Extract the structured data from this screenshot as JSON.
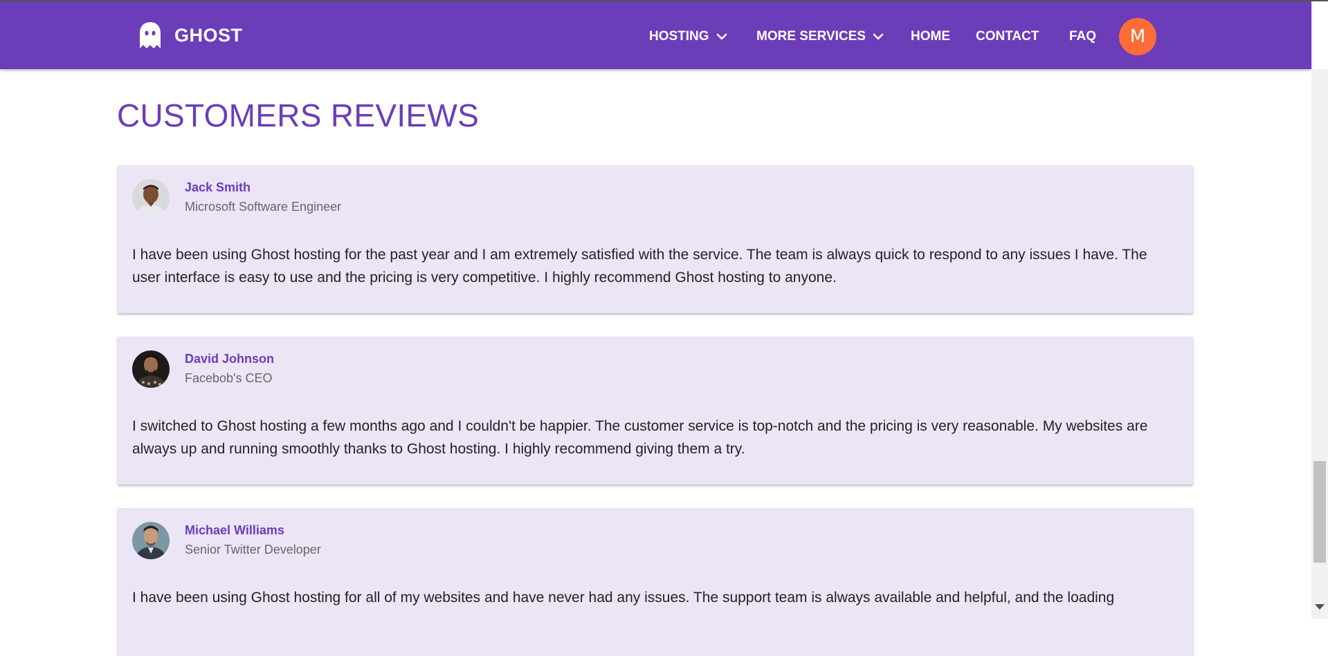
{
  "brand": {
    "name": "GHOST",
    "icon": "ghost-icon"
  },
  "nav": {
    "items": [
      {
        "label": "HOSTING",
        "dropdown": true
      },
      {
        "label": "MORE SERVICES",
        "dropdown": true
      },
      {
        "label": "HOME",
        "dropdown": false
      },
      {
        "label": "CONTACT",
        "dropdown": false
      },
      {
        "label": "FAQ",
        "dropdown": false
      }
    ],
    "avatar_initial": "M"
  },
  "colors": {
    "primary": "#6b3db8",
    "card_bg": "#ebe5f6",
    "avatar_bg": "#ff6c37"
  },
  "section": {
    "title": "CUSTOMERS REVIEWS"
  },
  "reviews": [
    {
      "name": "Jack Smith",
      "role": "Microsoft Software Engineer",
      "text": "I have been using Ghost hosting for the past year and I am extremely satisfied with the service. The team is always quick to respond to any issues I have. The user interface is easy to use and the pricing is very competitive. I highly recommend Ghost hosting to anyone."
    },
    {
      "name": "David Johnson",
      "role": "Facebob's CEO",
      "text": "I switched to Ghost hosting a few months ago and I couldn't be happier. The customer service is top-notch and the pricing is very reasonable. My websites are always up and running smoothly thanks to Ghost hosting. I highly recommend giving them a try."
    },
    {
      "name": "Michael Williams",
      "role": "Senior Twitter Developer",
      "text": "I have been using Ghost hosting for all of my websites and have never had any issues. The support team is always available and helpful, and the loading"
    }
  ]
}
